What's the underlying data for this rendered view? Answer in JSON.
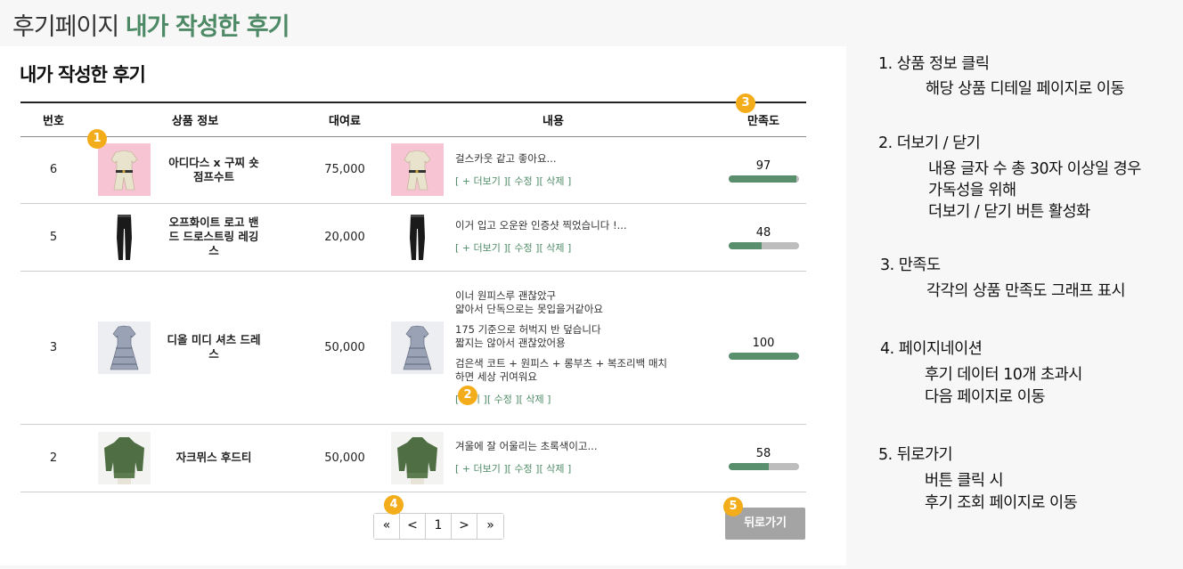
{
  "header": {
    "prefix": "후기페이지",
    "title": "내가 작성한 후기"
  },
  "panel": {
    "title": "내가 작성한 후기"
  },
  "table": {
    "headers": {
      "no": "번호",
      "product": "상품 정보",
      "price": "대여료",
      "content": "내용",
      "satisfaction": "만족도"
    },
    "rows": [
      {
        "no": "6",
        "product": "아디다스 x 구찌 숏 점프수트",
        "price": "75,000",
        "content": [
          "걸스카웃 같고 좋아요..."
        ],
        "actions": "[ + 더보기 ][ 수정 ][ 삭제 ]",
        "satisfaction": "97",
        "sat_pct": 0.97,
        "image": "jumpsuit"
      },
      {
        "no": "5",
        "product": "오프화이트 로고 밴드 드로스트링 레깅스",
        "price": "20,000",
        "content": [
          "이거 입고 오운완 인증샷 찍었습니다 !..."
        ],
        "actions": "[ + 더보기 ][ 수정 ][ 삭제 ]",
        "satisfaction": "48",
        "sat_pct": 0.48,
        "image": "leggings"
      },
      {
        "no": "3",
        "product": "디올 미디 셔츠 드레스",
        "price": "50,000",
        "content": [
          "이너 원피스루 괜찮았구",
          "얇아서 단독으로는 못입을거같아요",
          "",
          "175 기준으로 허벅지 반 덮습니다",
          "짧지는 않아서 괜찮았어용",
          "",
          "검은색 코트 + 원피스 + 롱부츠 + 복조리백 매치",
          "하면 세상 귀여워요"
        ],
        "actions": "[ 닫기 ][ 수정 ][ 삭제 ]",
        "satisfaction": "100",
        "sat_pct": 1.0,
        "image": "dress"
      },
      {
        "no": "2",
        "product": "자크뮈스 후드티",
        "price": "50,000",
        "content": [
          "겨울에 잘 어울리는 초록색이고..."
        ],
        "actions": "[ + 더보기 ][ 수정 ][ 삭제 ]",
        "satisfaction": "58",
        "sat_pct": 0.58,
        "image": "hoodie"
      }
    ]
  },
  "pagination": {
    "first": "«",
    "prev": "<",
    "page": "1",
    "next": ">",
    "last": "»"
  },
  "back_button": "뒤로가기",
  "badges": [
    "1",
    "2",
    "3",
    "4",
    "5"
  ],
  "notes": [
    {
      "head": "1.  상품 정보 클릭",
      "lines": [
        "해당 상품 디테일 페이지로 이동"
      ]
    },
    {
      "head": "2. 더보기 / 닫기",
      "lines": [
        "내용 글자 수 총 30자 이상일 경우",
        "가독성을 위해",
        "더보기 / 닫기 버튼 활성화"
      ]
    },
    {
      "head": "3. 만족도",
      "lines": [
        "각각의 상품 만족도 그래프 표시"
      ]
    },
    {
      "head": "4. 페이지네이션",
      "lines": [
        "후기 데이터 10개 초과시",
        "다음 페이지로 이동"
      ]
    },
    {
      "head": "5. 뒤로가기",
      "lines": [
        "버튼 클릭 시",
        "후기 조회 페이지로 이동"
      ]
    }
  ],
  "colors": {
    "accent": "#4e8a66",
    "badge": "#f4ad1a",
    "bar_fill": "#5a8f6e",
    "bar_bg": "#bdbdbd",
    "back_button": "#a4a4a4"
  }
}
